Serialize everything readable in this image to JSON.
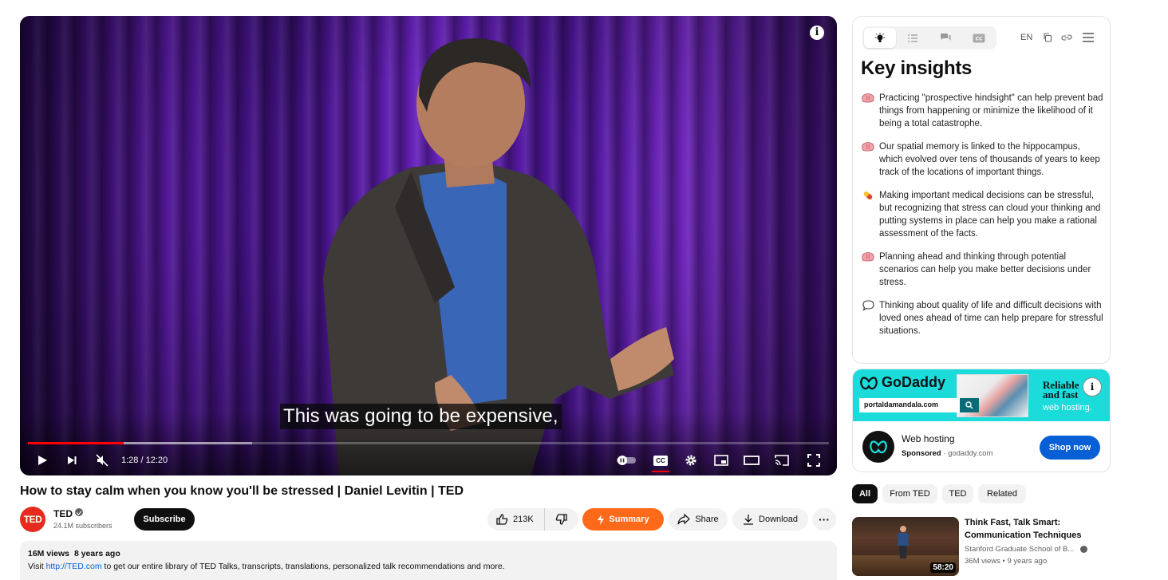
{
  "player": {
    "caption": "This was going to be expensive,",
    "time": "1:28 / 12:20",
    "progress_fraction": 0.12,
    "buffer_fraction": 0.28,
    "cc_label": "CC"
  },
  "video": {
    "title": "How to stay calm when you know you'll be stressed | Daniel Levitin | TED"
  },
  "channel": {
    "logo_text": "TED",
    "name": "TED",
    "subscribers": "24.1M subscribers",
    "subscribe_label": "Subscribe"
  },
  "actions": {
    "likes": "213K",
    "summary_label": "Summary",
    "share_label": "Share",
    "download_label": "Download",
    "more_label": "···"
  },
  "description": {
    "views": "16M views",
    "age": "8 years ago",
    "text_before": "Visit ",
    "link": "http://TED.com",
    "text_after": " to get our entire library of TED Talks, transcripts, translations, personalized talk recommendations and more."
  },
  "insights_panel": {
    "lang": "EN",
    "title": "Key insights",
    "items": [
      {
        "icon": "brain-icon",
        "text": "Practicing \"prospective hindsight\" can help prevent bad things from happening or minimize the likelihood of it being a total catastrophe."
      },
      {
        "icon": "brain-icon",
        "text": "Our spatial memory is linked to the hippocampus, which evolved over tens of thousands of years to keep track of the locations of important things."
      },
      {
        "icon": "pill-icon",
        "text": "Making important medical decisions can be stressful, but recognizing that stress can cloud your thinking and putting systems in place can help you make a rational assessment of the facts."
      },
      {
        "icon": "brain-icon",
        "text": "Planning ahead and thinking through potential scenarios can help you make better decisions under stress."
      },
      {
        "icon": "speech-bubble-icon",
        "text": "Thinking about quality of life and difficult decisions with loved ones ahead of time can help prepare for stressful situations."
      }
    ]
  },
  "ad": {
    "brand": "GoDaddy",
    "url_box": "portaldamandala.com",
    "headline": "Reliable and fast",
    "subline": "web hosting.",
    "title": "Web hosting",
    "sponsored": "Sponsored",
    "domain": "godaddy.com",
    "cta": "Shop now",
    "banner_color": "#1bdbdb"
  },
  "chips": [
    "All",
    "From TED",
    "TED",
    "Related"
  ],
  "recommendation": {
    "title": "Think Fast, Talk Smart: Communication Techniques",
    "channel": "Stanford Graduate School of B...",
    "views": "36M views",
    "age": "9 years ago",
    "duration": "58:20"
  },
  "colors": {
    "progress": "#ff0000",
    "summary_button": "#ff6a1a",
    "subscribe": "#0f0f0f",
    "link": "#065fd4",
    "ted_red": "#e62b1e"
  }
}
